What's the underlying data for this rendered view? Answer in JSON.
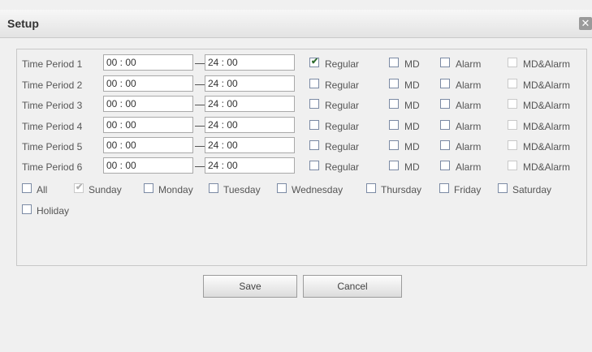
{
  "dialog": {
    "title": "Setup",
    "close_glyph": "✕"
  },
  "periods": [
    {
      "label": "Time Period 1",
      "start": "00 : 00",
      "end": "24 : 00",
      "regular": true,
      "md": false,
      "alarm": false,
      "mdalarm": false
    },
    {
      "label": "Time Period 2",
      "start": "00 : 00",
      "end": "24 : 00",
      "regular": false,
      "md": false,
      "alarm": false,
      "mdalarm": false
    },
    {
      "label": "Time Period 3",
      "start": "00 : 00",
      "end": "24 : 00",
      "regular": false,
      "md": false,
      "alarm": false,
      "mdalarm": false
    },
    {
      "label": "Time Period 4",
      "start": "00 : 00",
      "end": "24 : 00",
      "regular": false,
      "md": false,
      "alarm": false,
      "mdalarm": false
    },
    {
      "label": "Time Period 5",
      "start": "00 : 00",
      "end": "24 : 00",
      "regular": false,
      "md": false,
      "alarm": false,
      "mdalarm": false
    },
    {
      "label": "Time Period 6",
      "start": "00 : 00",
      "end": "24 : 00",
      "regular": false,
      "md": false,
      "alarm": false,
      "mdalarm": false
    }
  ],
  "record_types": {
    "regular": "Regular",
    "md": "MD",
    "alarm": "Alarm",
    "mdalarm": "MD&Alarm"
  },
  "days": [
    {
      "label": "All",
      "checked": false,
      "disabled": false
    },
    {
      "label": "Sunday",
      "checked": true,
      "disabled": true
    },
    {
      "label": "Monday",
      "checked": false,
      "disabled": false
    },
    {
      "label": "Tuesday",
      "checked": false,
      "disabled": false
    },
    {
      "label": "Wednesday",
      "checked": false,
      "disabled": false
    },
    {
      "label": "Thursday",
      "checked": false,
      "disabled": false
    },
    {
      "label": "Friday",
      "checked": false,
      "disabled": false
    },
    {
      "label": "Saturday",
      "checked": false,
      "disabled": false
    },
    {
      "label": "Holiday",
      "checked": false,
      "disabled": false
    }
  ],
  "buttons": {
    "save": "Save",
    "cancel": "Cancel"
  }
}
